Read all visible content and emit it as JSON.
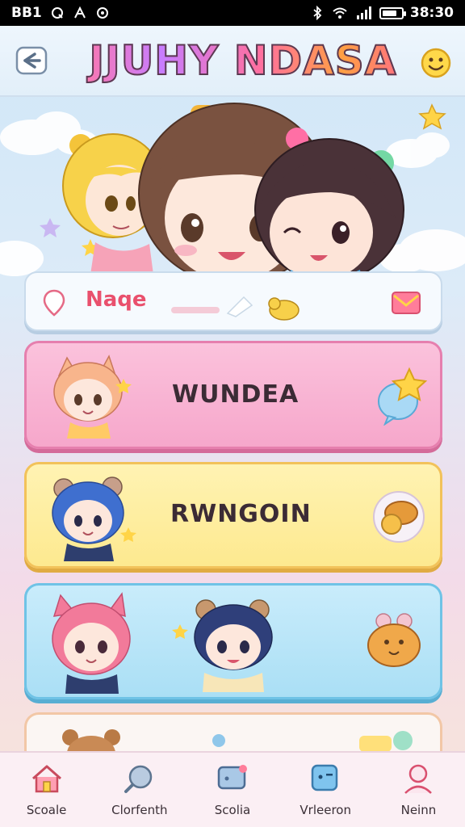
{
  "status_bar": {
    "left_text": "BB1",
    "right_time": "38:30",
    "battery_level": 0.8
  },
  "header": {
    "title": "JJUHY NDASA",
    "back_icon": "back-arrow-icon",
    "right_icon": "smiley-icon"
  },
  "name_bar": {
    "label": "Naqe",
    "left_icon": "location-pin-icon",
    "right_icon": "envelope-icon"
  },
  "cards": [
    {
      "label": "WUNDEA",
      "color": "#f6a7cb",
      "right_icon": "star-bubble-icon"
    },
    {
      "label": "RWNGOIN",
      "color": "#fde98f",
      "right_icon": "food-icon"
    },
    {
      "label": "",
      "color": "#aadff5",
      "right_icon": "bear-pastry-icon"
    },
    {
      "label": "",
      "color": "#fbf6f3"
    }
  ],
  "bottom_nav": [
    {
      "label": "Scoale",
      "icon": "house-icon"
    },
    {
      "label": "Clorfenth",
      "icon": "search-icon"
    },
    {
      "label": "Scolia",
      "icon": "chat-icon"
    },
    {
      "label": "Vrleeron",
      "icon": "game-icon"
    },
    {
      "label": "Neinn",
      "icon": "profile-icon"
    }
  ]
}
